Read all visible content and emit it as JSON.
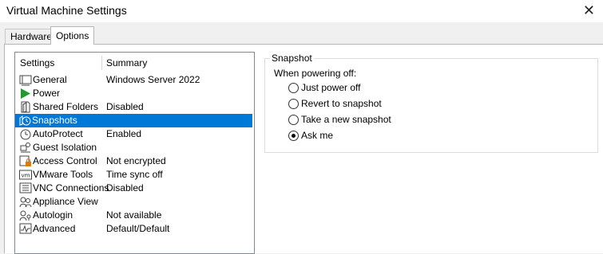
{
  "window": {
    "title": "Virtual Machine Settings"
  },
  "tabs": [
    {
      "label": "Hardware",
      "active": false
    },
    {
      "label": "Options",
      "active": true
    }
  ],
  "list": {
    "headers": {
      "settings": "Settings",
      "summary": "Summary"
    },
    "items": [
      {
        "label": "General",
        "summary": "Windows Server 2022",
        "icon": "general-icon"
      },
      {
        "label": "Power",
        "summary": "",
        "icon": "power-play-icon"
      },
      {
        "label": "Shared Folders",
        "summary": "Disabled",
        "icon": "shared-folders-icon"
      },
      {
        "label": "Snapshots",
        "summary": "",
        "icon": "snapshots-icon",
        "selected": true
      },
      {
        "label": "AutoProtect",
        "summary": "Enabled",
        "icon": "autoprotect-clock-icon"
      },
      {
        "label": "Guest Isolation",
        "summary": "",
        "icon": "guest-isolation-icon"
      },
      {
        "label": "Access Control",
        "summary": "Not encrypted",
        "icon": "access-control-icon"
      },
      {
        "label": "VMware Tools",
        "summary": "Time sync off",
        "icon": "vmware-tools-icon"
      },
      {
        "label": "VNC Connections",
        "summary": "Disabled",
        "icon": "vnc-connections-icon"
      },
      {
        "label": "Appliance View",
        "summary": "",
        "icon": "appliance-view-icon"
      },
      {
        "label": "Autologin",
        "summary": "Not available",
        "icon": "autologin-icon"
      },
      {
        "label": "Advanced",
        "summary": "Default/Default",
        "icon": "advanced-icon"
      }
    ]
  },
  "snapshot": {
    "group_label": "Snapshot",
    "prompt": "When powering off:",
    "options": [
      {
        "label": "Just power off",
        "checked": false
      },
      {
        "label": "Revert to snapshot",
        "checked": false
      },
      {
        "label": "Take a new snapshot",
        "checked": false
      },
      {
        "label": "Ask me",
        "checked": true
      }
    ]
  },
  "colors": {
    "selection": "#0078d7",
    "power_green": "#1e9a2e",
    "lock_orange": "#e07b00"
  }
}
